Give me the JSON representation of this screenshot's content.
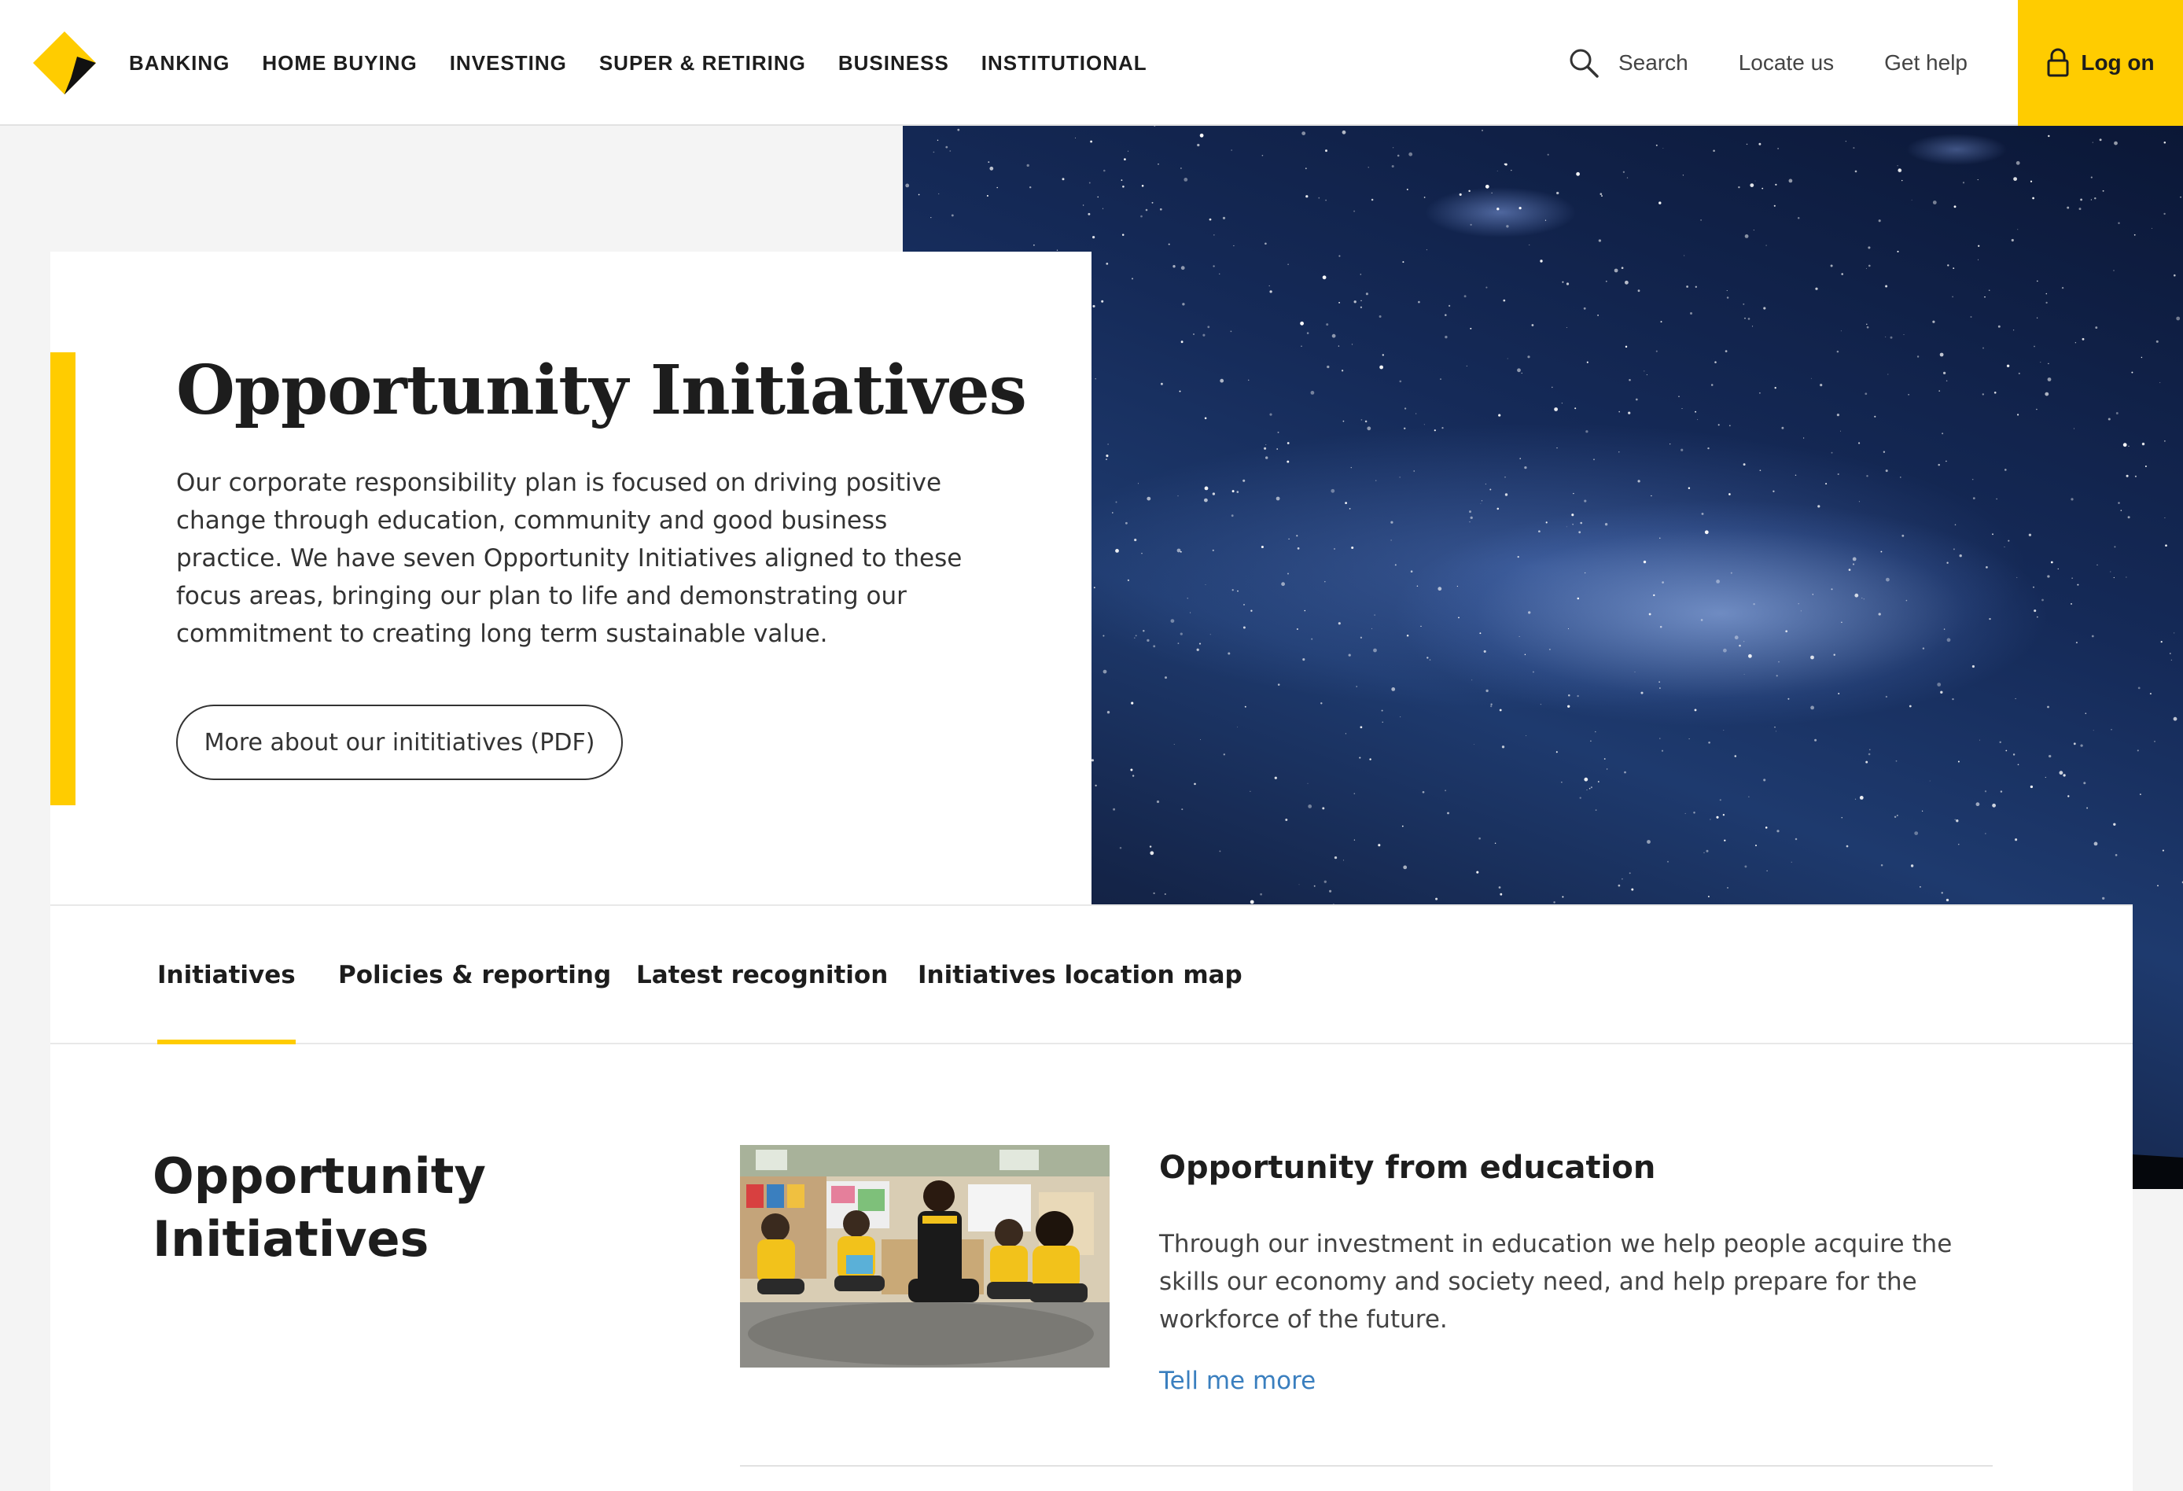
{
  "header": {
    "nav": [
      "BANKING",
      "HOME BUYING",
      "INVESTING",
      "SUPER & RETIRING",
      "BUSINESS",
      "INSTITUTIONAL"
    ],
    "search_label": "Search",
    "locate_label": "Locate us",
    "help_label": "Get help",
    "logon_label": "Log on"
  },
  "hero": {
    "title": "Opportunity Initiatives",
    "description": "Our corporate responsibility plan is focused on driving positive change through education, community and good business practice. We have seven Opportunity Initiatives aligned to these focus areas, bringing our plan to life and demonstrating our commitment to creating long term sustainable value.",
    "button_label": "More about our inititiatives (PDF)"
  },
  "tabs": [
    {
      "label": "Initiatives",
      "active": true
    },
    {
      "label": "Policies & reporting",
      "active": false
    },
    {
      "label": "Latest recognition",
      "active": false
    },
    {
      "label": "Initiatives location map",
      "active": false
    }
  ],
  "content": {
    "section_title": "Opportunity Initiatives",
    "card": {
      "title": "Opportunity from education",
      "description": "Through our investment in education we help people acquire the skills our economy and society need, and help prepare for the workforce of the future.",
      "link_label": "Tell me more"
    }
  },
  "colors": {
    "brand_yellow": "#ffcc00",
    "text_dark": "#1d1d1d",
    "link_blue": "#3a7fbf"
  },
  "icons": {
    "logo": "diamond-logo-icon",
    "search": "search-icon",
    "lock": "lock-icon"
  }
}
